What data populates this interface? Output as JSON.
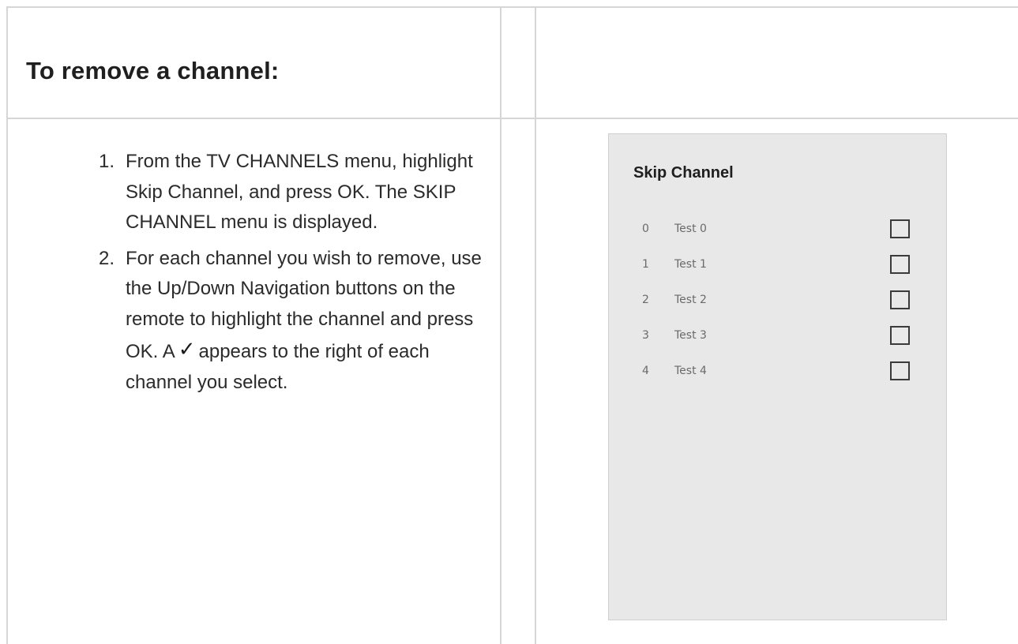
{
  "heading": "To remove a channel:",
  "steps": [
    {
      "number": "1.",
      "text": "From the TV CHANNELS menu, highlight Skip Channel, and press OK. The SKIP CHANNEL menu is displayed."
    },
    {
      "number": "2.",
      "text_before": "For each channel you wish to remove, use the Up/Down Navigation buttons on the remote to highlight the channel and press OK. A",
      "icon": "checkmark-icon",
      "icon_glyph": "✓",
      "text_after": "appears to the right of each channel you select."
    }
  ],
  "skip_channel_menu": {
    "title": "Skip Channel",
    "channels": [
      {
        "number": "0",
        "name": "Test 0",
        "checked": false
      },
      {
        "number": "1",
        "name": "Test 1",
        "checked": false
      },
      {
        "number": "2",
        "name": "Test 2",
        "checked": false
      },
      {
        "number": "3",
        "name": "Test 3",
        "checked": false
      },
      {
        "number": "4",
        "name": "Test 4",
        "checked": false
      }
    ],
    "background_color": "#e8e8e8"
  },
  "colors": {
    "table_border": "#d6d6d6",
    "text": "#2b2b2b"
  }
}
